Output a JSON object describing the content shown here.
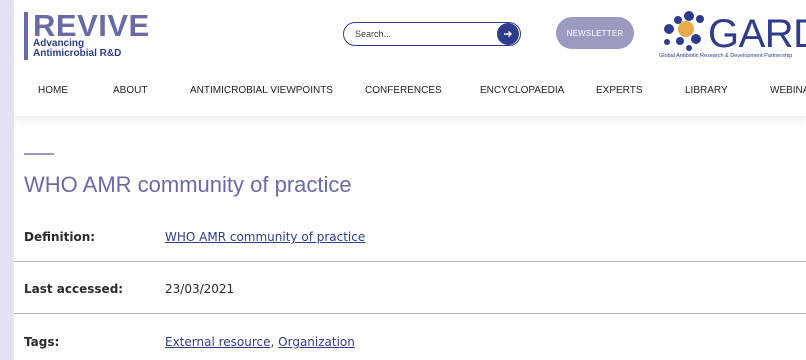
{
  "logo": {
    "title": "REVIVE",
    "subtitle_line1": "Advancing",
    "subtitle_line2": "Antimicrobial R&D"
  },
  "search": {
    "placeholder": "Search...",
    "button_icon": "arrow-right-icon"
  },
  "newsletter": {
    "label": "NEWSLETTER"
  },
  "partner": {
    "name": "GARDP",
    "tagline": "Global Antibiotic Research & Development Partnership",
    "icon": "gardp-dots-logo"
  },
  "nav": {
    "items": [
      {
        "label": "HOME"
      },
      {
        "label": "ABOUT"
      },
      {
        "label": "ANTIMICROBIAL VIEWPOINTS"
      },
      {
        "label": "CONFERENCES"
      },
      {
        "label": "ENCYCLOPAEDIA"
      },
      {
        "label": "EXPERTS"
      },
      {
        "label": "LIBRARY"
      },
      {
        "label": "WEBINARS"
      }
    ]
  },
  "content": {
    "title": "WHO AMR community of practice",
    "definition": {
      "label": "Definition:",
      "value": "WHO AMR community of practice"
    },
    "last_accessed": {
      "label": "Last accessed:",
      "value": "23/03/2021"
    },
    "tags": {
      "label": "Tags:",
      "tag1": "External resource",
      "separator": ", ",
      "tag2": "Organization"
    }
  },
  "colors": {
    "brand_purple": "#6a6aa6",
    "brand_navy": "#2f3c8c",
    "newsletter_bg": "#9b9ac0",
    "page_backdrop": "#e7e2f3"
  }
}
